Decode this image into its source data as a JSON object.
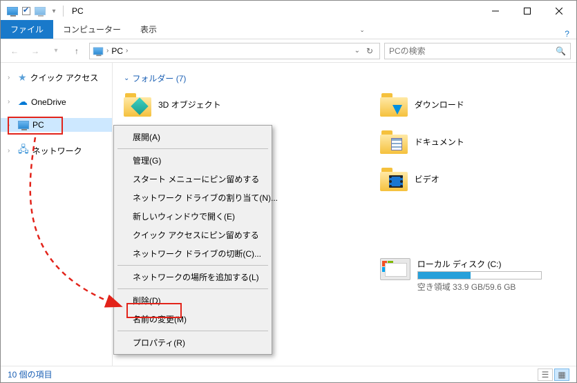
{
  "window": {
    "title": "PC"
  },
  "tabs": {
    "file": "ファイル",
    "computer": "コンピューター",
    "view": "表示"
  },
  "address": {
    "location": "PC",
    "separator": "›"
  },
  "search": {
    "placeholder": "PCの検索"
  },
  "nav": {
    "quick_access": "クイック アクセス",
    "onedrive": "OneDrive",
    "pc": "PC",
    "network": "ネットワーク"
  },
  "section": {
    "folders_header": "フォルダー (7)"
  },
  "folders": {
    "objects3d": "3D オブジェクト",
    "downloads": "ダウンロード",
    "documents": "ドキュメント",
    "videos": "ビデオ"
  },
  "drive": {
    "label": "ローカル ディスク (C:)",
    "free_text": "空き領域 33.9 GB/59.6 GB",
    "fill_percent": 43
  },
  "context_menu": {
    "expand": "展開(A)",
    "manage": "管理(G)",
    "pin_start": "スタート メニューにピン留めする",
    "map_drive": "ネットワーク ドライブの割り当て(N)...",
    "new_window": "新しいウィンドウで開く(E)",
    "pin_quick": "クイック アクセスにピン留めする",
    "disconnect_drive": "ネットワーク ドライブの切断(C)...",
    "add_network_location": "ネットワークの場所を追加する(L)",
    "delete": "削除(D)",
    "rename": "名前の変更(M)",
    "properties": "プロパティ(R)"
  },
  "status": {
    "items": "10 個の項目"
  }
}
